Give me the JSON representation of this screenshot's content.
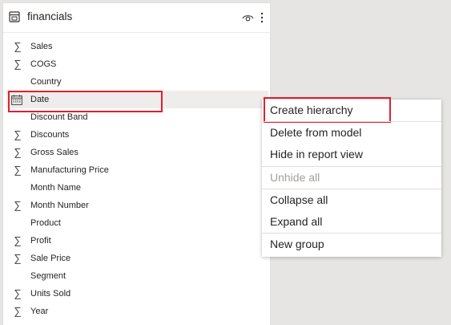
{
  "pane": {
    "title": "financials",
    "table_icon": "table-icon",
    "visibility_icon": "eye-icon",
    "more_icon": "more-options-icon"
  },
  "fields": [
    {
      "label": "Sales",
      "icon": "sigma-icon"
    },
    {
      "label": "COGS",
      "icon": "sigma-icon"
    },
    {
      "label": "Country",
      "icon": ""
    },
    {
      "label": "Date",
      "icon": "calendar-icon",
      "selected": true
    },
    {
      "label": "Discount Band",
      "icon": ""
    },
    {
      "label": "Discounts",
      "icon": "sigma-icon"
    },
    {
      "label": "Gross Sales",
      "icon": "sigma-icon"
    },
    {
      "label": "Manufacturing Price",
      "icon": "sigma-icon"
    },
    {
      "label": "Month Name",
      "icon": ""
    },
    {
      "label": "Month Number",
      "icon": "sigma-icon"
    },
    {
      "label": "Product",
      "icon": ""
    },
    {
      "label": "Profit",
      "icon": "sigma-icon"
    },
    {
      "label": "Sale Price",
      "icon": "sigma-icon"
    },
    {
      "label": "Segment",
      "icon": ""
    },
    {
      "label": "Units Sold",
      "icon": "sigma-icon"
    },
    {
      "label": "Year",
      "icon": "sigma-icon"
    }
  ],
  "context_menu": {
    "items": [
      {
        "label": "Create hierarchy",
        "disabled": false,
        "highlighted": true
      },
      {
        "label": "Delete from model",
        "disabled": false
      },
      {
        "label": "Hide in report view",
        "disabled": false
      },
      {
        "label": "Unhide all",
        "disabled": true
      },
      {
        "label": "Collapse all",
        "disabled": false
      },
      {
        "label": "Expand all",
        "disabled": false
      },
      {
        "label": "New group",
        "disabled": false
      }
    ]
  },
  "colors": {
    "highlight_border": "#e02030",
    "background": "#e6e5e4",
    "disabled_text": "#a19f9d"
  }
}
